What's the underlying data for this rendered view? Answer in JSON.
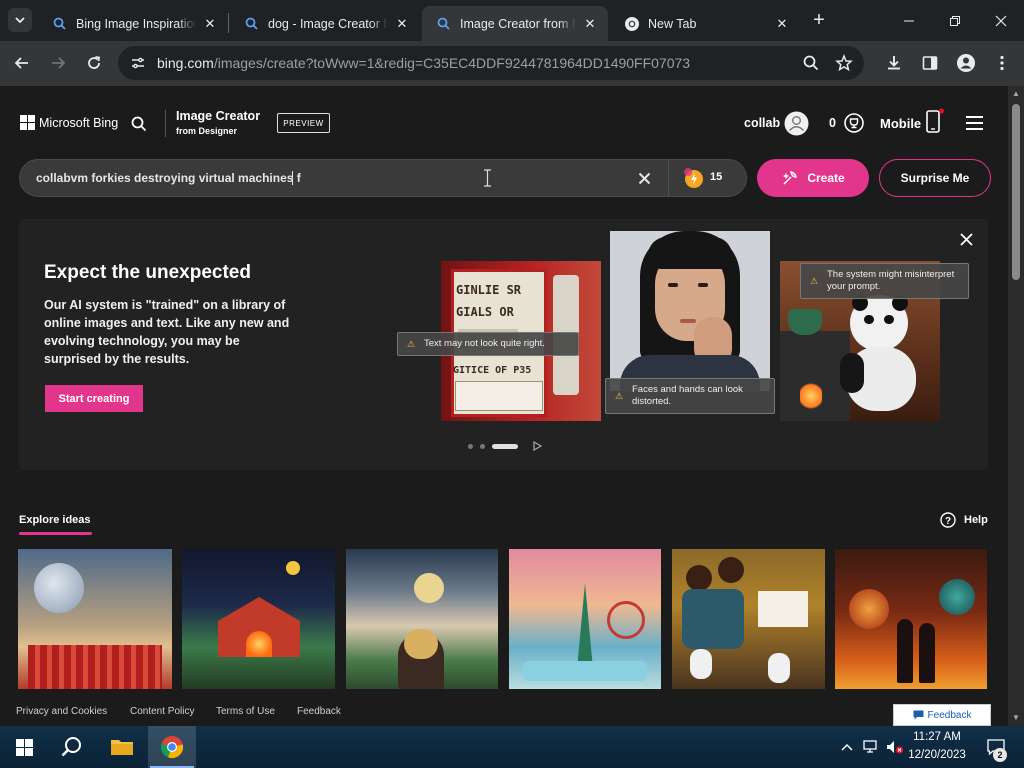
{
  "browser": {
    "tabs": [
      {
        "title": "Bing Image Inspiration",
        "active": false
      },
      {
        "title": "dog - Image Creator fr",
        "active": false
      },
      {
        "title": "Image Creator from M",
        "active": true
      },
      {
        "title": "New Tab",
        "active": false
      }
    ],
    "new_tab_icon": "plus-icon",
    "url_host": "bing.com",
    "url_path": "/images/create?toWww=1&redig=C35EC4DDF9244781964DD1490FF07073"
  },
  "header": {
    "brand": "Microsoft Bing",
    "product_title": "Image Creator",
    "product_subtitle": "from Designer",
    "preview_badge": "PREVIEW",
    "username": "collab",
    "rewards_count": "0",
    "mobile_label": "Mobile"
  },
  "search": {
    "value": "collabvm forkies destroying virtual machines f",
    "boost_count": "15",
    "create_label": "Create",
    "surprise_label": "Surprise Me"
  },
  "promo": {
    "title": "Expect the unexpected",
    "body": "Our AI system is \"trained\" on a library of online images and text. Like any new and evolving technology, you may be surprised by the results.",
    "cta": "Start creating",
    "tips": [
      "Text may not look quite right.",
      "Faces and hands can look distorted.",
      "The system might misinterpret your prompt."
    ],
    "sign_lines": [
      "GINLIE SR",
      "GIALS OR",
      "GITICE OF P35"
    ]
  },
  "explore": {
    "title": "Explore ideas",
    "help": "Help"
  },
  "footer": {
    "links": [
      "Privacy and Cookies",
      "Content Policy",
      "Terms of Use",
      "Feedback"
    ],
    "feedback_button": "Feedback"
  },
  "taskbar": {
    "time": "11:27 AM",
    "date": "12/20/2023",
    "notification_count": "2"
  },
  "colors": {
    "accent": "#e2368c",
    "page_bg": "#1b1b1b",
    "chrome_bg": "#202124"
  }
}
